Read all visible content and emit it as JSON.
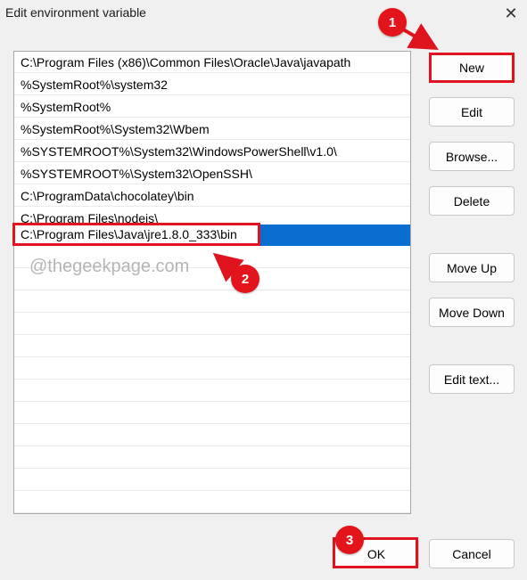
{
  "window": {
    "title": "Edit environment variable",
    "close_glyph": "✕"
  },
  "entries": [
    "C:\\Program Files (x86)\\Common Files\\Oracle\\Java\\javapath",
    "%SystemRoot%\\system32",
    "%SystemRoot%",
    "%SystemRoot%\\System32\\Wbem",
    "%SYSTEMROOT%\\System32\\WindowsPowerShell\\v1.0\\",
    "%SYSTEMROOT%\\System32\\OpenSSH\\",
    "C:\\ProgramData\\chocolatey\\bin",
    "C:\\Program Files\\nodejs\\"
  ],
  "editing_entry": "C:\\Program Files\\Java\\jre1.8.0_333\\bin",
  "buttons": {
    "new": "New",
    "edit": "Edit",
    "browse": "Browse...",
    "delete": "Delete",
    "move_up": "Move Up",
    "move_down": "Move Down",
    "edit_text": "Edit text...",
    "ok": "OK",
    "cancel": "Cancel"
  },
  "annotations": {
    "step1": "1",
    "step2": "2",
    "step3": "3",
    "color": "#e0141e"
  },
  "watermark": "@thegeekpage.com",
  "colors": {
    "selection": "#0a6ed1",
    "dialog_bg": "#f0f0f0"
  }
}
